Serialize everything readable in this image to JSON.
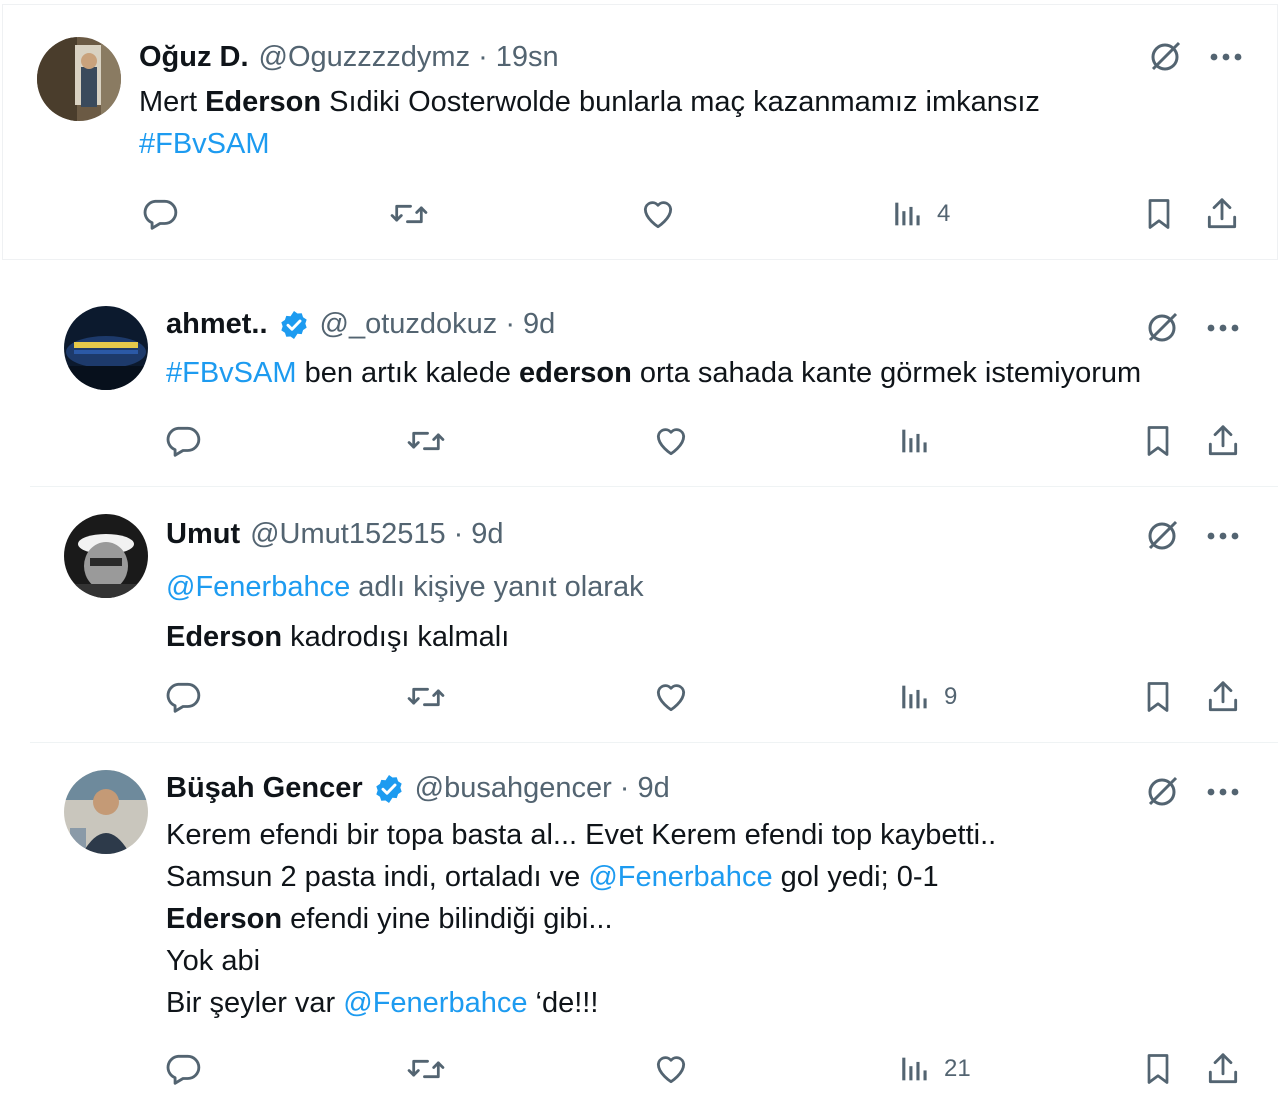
{
  "tweets": [
    {
      "name": "Oğuz D.",
      "handle": "@Oguzzzzdymz",
      "time": "19sn",
      "verified": false,
      "text": {
        "line1_pre": "Mert ",
        "line1_bold": "Ederson",
        "line1_post": " Sıdiki Oosterwolde bunlarla maç kazanmamız imkansız",
        "line2_link": "#FBvSAM"
      },
      "views": "4"
    },
    {
      "name": "ahmet..",
      "handle": "@_otuzdokuz",
      "time": "9d",
      "verified": true,
      "text": {
        "link": "#FBvSAM",
        "pre": " ben artık kalede ",
        "bold": "ederson",
        "post": " orta sahada kante görmek istemiyorum"
      },
      "views": ""
    },
    {
      "name": "Umut",
      "handle": "@Umut152515",
      "time": "9d",
      "verified": false,
      "text": {
        "reply_link": "@Fenerbahce",
        "reply_rest": " adlı kişiye yanıt olarak",
        "bold": "Ederson",
        "post": " kadrodışı kalmalı"
      },
      "views": "9"
    },
    {
      "name": "Büşah Gencer",
      "handle": "@busahgencer",
      "time": "9d",
      "verified": true,
      "text": {
        "line1": "Kerem efendi bir topa basta al... Evet Kerem efendi top kaybetti..",
        "line2_pre": "Samsun 2 pasta indi, ortaladı ve ",
        "line2_link": "@Fenerbahce",
        "line2_post": " gol yedi; 0-1",
        "line3_bold": "Ederson",
        "line3_post": " efendi yine bilindiği gibi...",
        "line4": "Yok abi",
        "line5_pre": "Bir şeyler var ",
        "line5_link": "@Fenerbahce",
        "line5_post": " ‘de!!!"
      },
      "views": "21"
    }
  ],
  "separator": "·",
  "icons": [
    "grok-icon",
    "more-icon",
    "reply-icon",
    "retweet-icon",
    "like-icon",
    "views-icon",
    "bookmark-icon",
    "share-icon"
  ],
  "colors": {
    "link": "#1d9bf0",
    "muted": "#536471",
    "text": "#0f1419",
    "verified": "#1d9bf0"
  }
}
